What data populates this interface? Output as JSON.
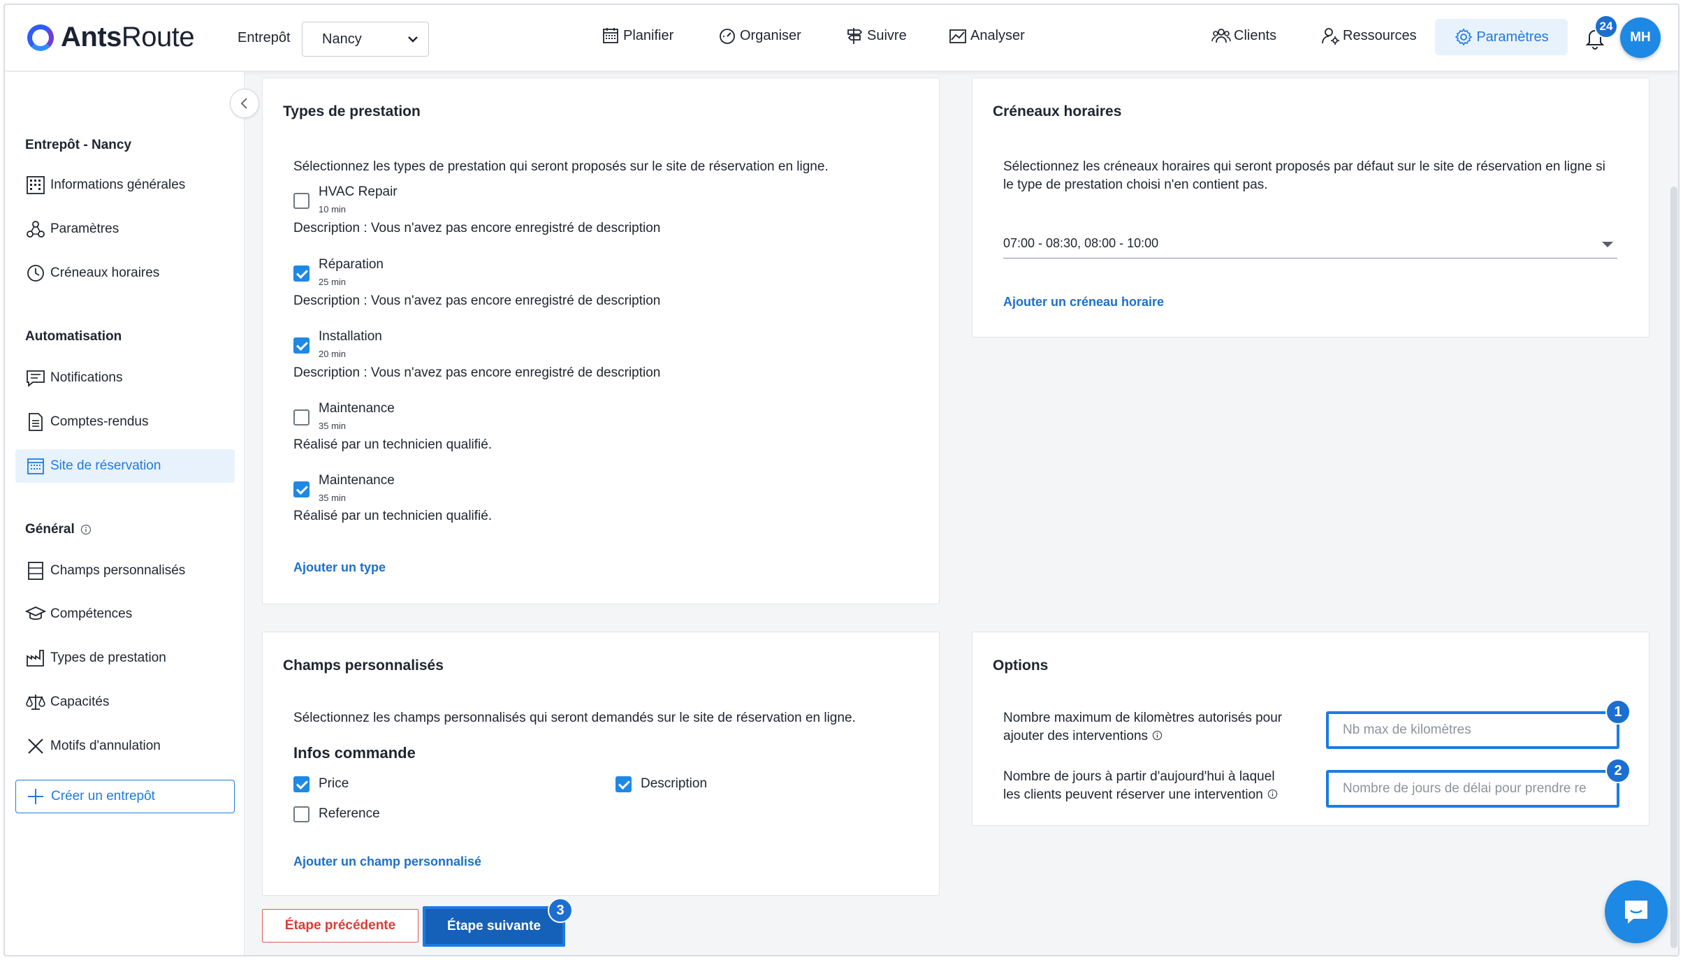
{
  "app": {
    "logo_bold": "Ants",
    "logo_light": "Route"
  },
  "header": {
    "warehouse_label": "Entrepôt",
    "warehouse_value": "Nancy",
    "nav": [
      {
        "label": "Planifier",
        "icon": "calendar-icon"
      },
      {
        "label": "Organiser",
        "icon": "gauge-icon"
      },
      {
        "label": "Suivre",
        "icon": "signpost-icon"
      },
      {
        "label": "Analyser",
        "icon": "chart-icon"
      },
      {
        "label": "Clients",
        "icon": "users-icon"
      },
      {
        "label": "Ressources",
        "icon": "resource-icon"
      },
      {
        "label": "Paramètres",
        "icon": "gear-icon"
      }
    ],
    "notification_count": "24",
    "avatar_initials": "MH"
  },
  "sidebar": {
    "section_warehouse": "Entrepôt - Nancy",
    "warehouse_items": [
      "Informations générales",
      "Paramètres",
      "Créneaux horaires"
    ],
    "section_automation": "Automatisation",
    "automation_items": [
      "Notifications",
      "Comptes-rendus",
      "Site de réservation"
    ],
    "section_general": "Général",
    "general_items": [
      "Champs personnalisés",
      "Compétences",
      "Types de prestation",
      "Capacités",
      "Motifs d'annulation"
    ],
    "create_button": "Créer un entrepôt",
    "active_item": "Site de réservation"
  },
  "services_card": {
    "title": "Types de prestation",
    "intro": "Sélectionnez les types de prestation qui seront proposés sur le site de réservation en ligne.",
    "items": [
      {
        "name": "HVAC Repair",
        "duration": "10 min",
        "description": "Description : Vous n'avez pas encore enregistré de description",
        "checked": false
      },
      {
        "name": "Réparation",
        "duration": "25 min",
        "description": "Description : Vous n'avez pas encore enregistré de description",
        "checked": true
      },
      {
        "name": "Installation",
        "duration": "20 min",
        "description": "Description : Vous n'avez pas encore enregistré de description",
        "checked": true
      },
      {
        "name": "Maintenance",
        "duration": "35 min",
        "description": "Réalisé par un technicien qualifié.",
        "checked": false
      },
      {
        "name": "Maintenance",
        "duration": "35 min",
        "description": "Réalisé par un technicien qualifié.",
        "checked": true
      }
    ],
    "add_link": "Ajouter un type"
  },
  "slots_card": {
    "title": "Créneaux horaires",
    "intro": "Sélectionnez les créneaux horaires qui seront proposés par défaut sur le site de réservation en ligne si le type de prestation choisi n'en contient pas.",
    "selected": "07:00 - 08:30, 08:00 - 10:00",
    "add_link": "Ajouter un créneau horaire"
  },
  "custom_fields_card": {
    "title": "Champs personnalisés",
    "intro": "Sélectionnez les champs personnalisés qui seront demandés sur le site de réservation en ligne.",
    "group_title": "Infos commande",
    "fields": [
      {
        "label": "Price",
        "checked": true
      },
      {
        "label": "Description",
        "checked": true
      },
      {
        "label": "Reference",
        "checked": false
      }
    ],
    "add_link": "Ajouter un champ personnalisé"
  },
  "options_card": {
    "title": "Options",
    "km_label_line1": "Nombre maximum de kilomètres autorisés pour",
    "km_label_line2": "ajouter des interventions",
    "km_placeholder": "Nb max de kilomètres",
    "days_label_line1": "Nombre de jours à partir d'aujourd'hui à laquel",
    "days_label_line2": "les clients peuvent réserver une intervention",
    "days_placeholder": "Nombre de jours de délai pour prendre re"
  },
  "footer": {
    "prev_button": "Étape précédente",
    "next_button": "Étape suivante"
  },
  "step_badges": [
    "1",
    "2",
    "3"
  ],
  "colors": {
    "accent": "#1e7be0",
    "highlight": "#1c7be3",
    "danger": "#d93d36",
    "primary_button": "#1560b8"
  }
}
